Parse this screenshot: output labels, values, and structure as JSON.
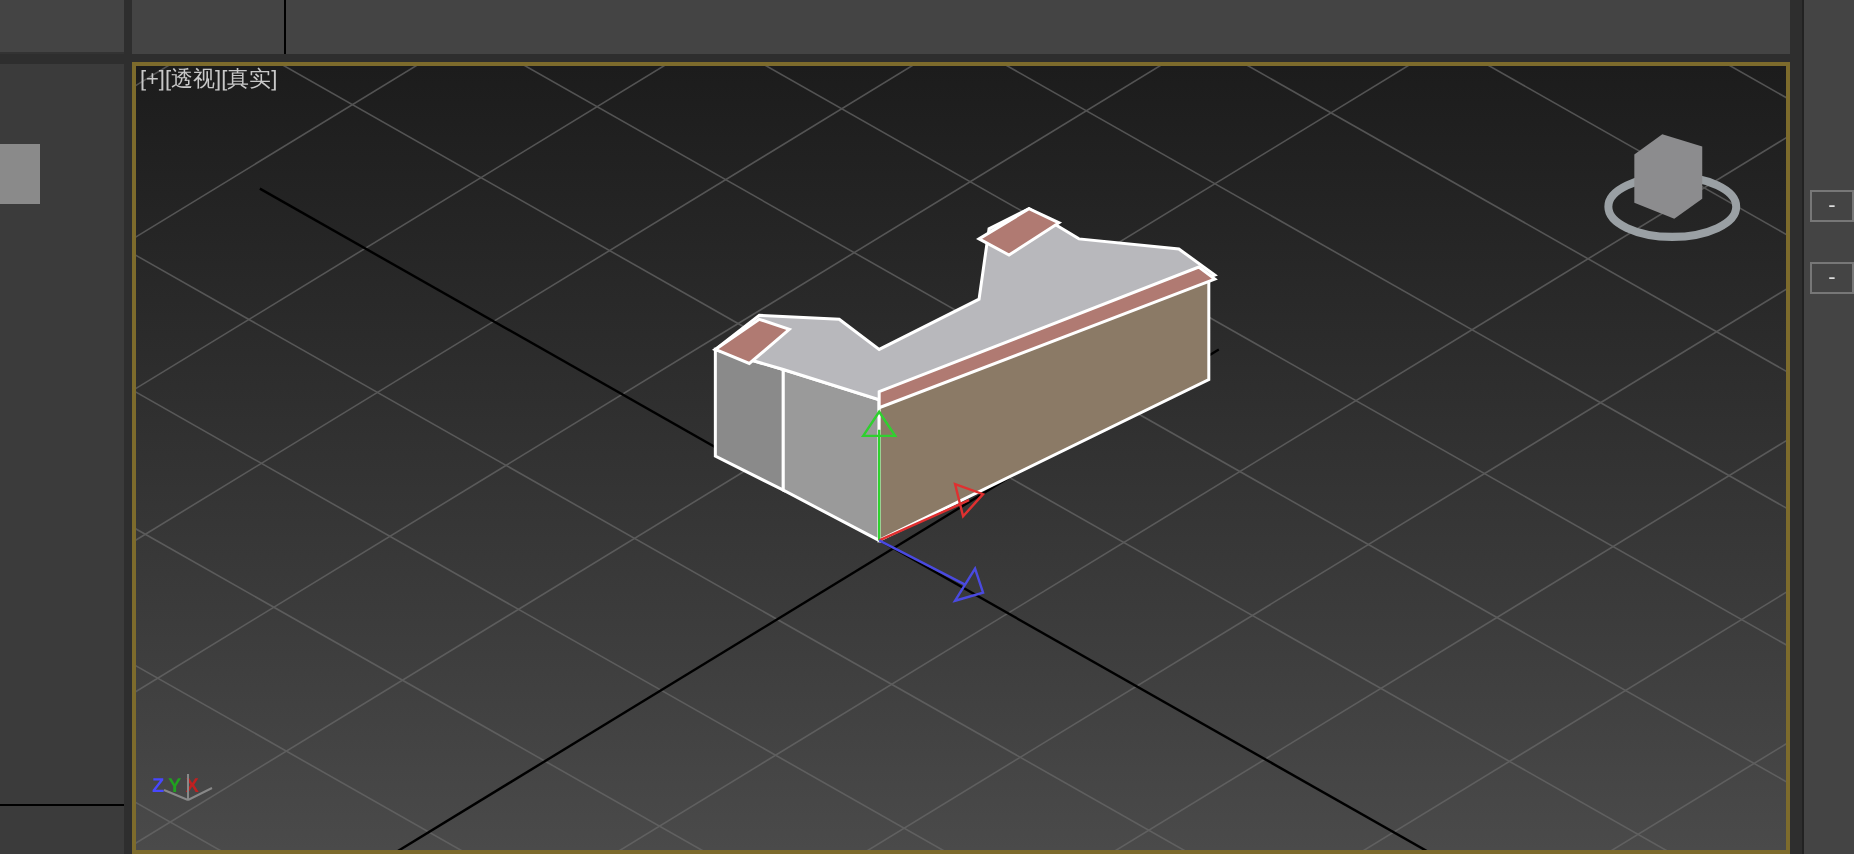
{
  "viewport": {
    "active": true,
    "labels": [
      {
        "text": "[+]"
      },
      {
        "text": "[透视]"
      },
      {
        "text": "[真实]"
      }
    ],
    "axis_tripod": [
      {
        "text": "Z",
        "color": "#4848ff"
      },
      {
        "text": "Y",
        "color": "#20a020"
      },
      {
        "text": "X",
        "color": "#c02020"
      }
    ]
  },
  "command_panel": {
    "rollouts": [
      {
        "toggle": "-"
      },
      {
        "toggle": "-"
      }
    ]
  }
}
